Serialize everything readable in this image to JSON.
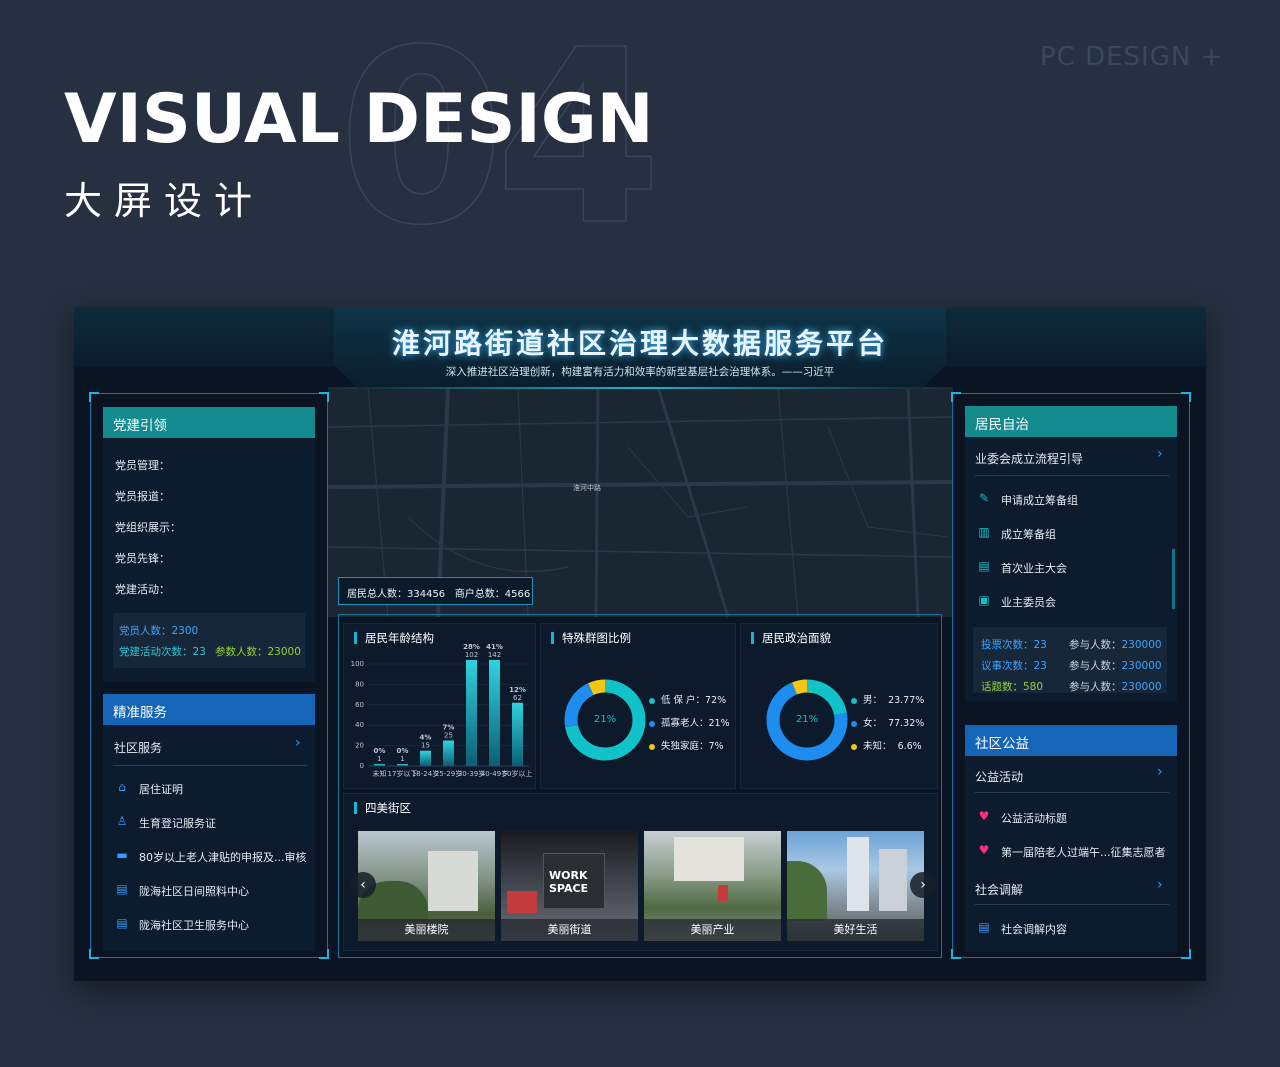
{
  "page": {
    "corner_tag": "PC DESIGN +",
    "big_number": "04",
    "title": "VISUAL DESIGN",
    "subtitle": "大屏设计"
  },
  "dashboard": {
    "title": "淮河路街道社区治理大数据服务平台",
    "quote": "深入推进社区治理创新，构建富有活力和效率的新型基层社会治理体系。——习近平",
    "map_road_label": "淮河中路",
    "population": {
      "residents_label": "居民总人数：",
      "residents_value": "334456",
      "merchants_label": "商户总数：",
      "merchants_value": "4566"
    }
  },
  "left": {
    "party": {
      "title": "党建引领",
      "items": [
        "党员管理：",
        "党员报道：",
        "党组织展示：",
        "党员先锋：",
        "党建活动："
      ],
      "stats": {
        "members_label": "党员人数：",
        "members_value": "2300",
        "activities_label": "党建活动次数：",
        "activities_value": "23",
        "participants_label": "参数人数：",
        "participants_value": "23000"
      }
    },
    "service": {
      "title": "精准服务",
      "section": "社区服务",
      "items": [
        {
          "label": "居住证明",
          "icon": "home-icon"
        },
        {
          "label": "生育登记服务证",
          "icon": "baby-icon"
        },
        {
          "label": "80岁以上老人津贴的申报及...审核",
          "icon": "card-icon"
        },
        {
          "label": "陇海社区日间照料中心",
          "icon": "document-icon"
        },
        {
          "label": "陇海社区卫生服务中心",
          "icon": "document-icon"
        }
      ]
    }
  },
  "center": {
    "age_chart_title": "居民年龄结构",
    "special_title": "特殊群图比例",
    "political_title": "居民政治面貌",
    "streets_title": "四美街区",
    "special_center": "21%",
    "special_legend": [
      {
        "label": "低 保 户：",
        "value": "72%",
        "color": "#11c3c9"
      },
      {
        "label": "孤寡老人：",
        "value": "21%",
        "color": "#1e8df0"
      },
      {
        "label": "失独家庭：",
        "value": "7%",
        "color": "#f5c614"
      }
    ],
    "political_center": "21%",
    "political_legend": [
      {
        "label": "男：",
        "value": "23.77%",
        "color": "#11c3c9"
      },
      {
        "label": "女：",
        "value": "77.32%",
        "color": "#1e8df0"
      },
      {
        "label": "未知：",
        "value": "6.6%",
        "color": "#f5c614"
      }
    ],
    "photos": [
      "美丽楼院",
      "美丽街道",
      "美丽产业",
      "美好生活"
    ]
  },
  "chart_data": [
    {
      "type": "bar",
      "title": "居民年龄结构",
      "categories": [
        "未知",
        "17岁以下",
        "18-24岁",
        "25-29岁",
        "30-39岁",
        "40-49岁",
        "50岁以上"
      ],
      "values": [
        1,
        1,
        15,
        25,
        102,
        142,
        62
      ],
      "percent_labels": [
        "0%",
        "0%",
        "4%",
        "7%",
        "28%",
        "41%",
        "12%"
      ],
      "yticks": [
        0,
        20,
        40,
        60,
        80,
        100
      ],
      "ylim": [
        0,
        100
      ]
    },
    {
      "type": "pie",
      "title": "特殊群图比例",
      "labels": [
        "低保户",
        "孤寡老人",
        "失独家庭"
      ],
      "values": [
        72,
        21,
        7
      ]
    },
    {
      "type": "pie",
      "title": "居民政治面貌",
      "labels": [
        "男",
        "女",
        "未知"
      ],
      "values": [
        23.77,
        77.32,
        6.6
      ]
    }
  ],
  "right": {
    "autonomy": {
      "title": "居民自治",
      "section": "业委会成立流程引导",
      "items": [
        {
          "label": "申请成立筹备组",
          "icon": "pen-icon"
        },
        {
          "label": "成立筹备组",
          "icon": "book-icon"
        },
        {
          "label": "首次业主大会",
          "icon": "chat-icon"
        },
        {
          "label": "业主委员会",
          "icon": "clipboard-icon"
        }
      ],
      "stats": [
        {
          "label": "投票次数：",
          "value": "23",
          "plabel": "参与人数：",
          "pvalue": "230000"
        },
        {
          "label": "议事次数：",
          "value": "23",
          "plabel": "参与人数：",
          "pvalue": "230000"
        },
        {
          "label": "话题数：",
          "value": "580",
          "plabel": "参与人数：",
          "pvalue": "230000"
        }
      ]
    },
    "welfare": {
      "title": "社区公益",
      "section1": "公益活动",
      "items": [
        "公益活动标题",
        "第一届陪老人过端午...征集志愿者"
      ],
      "section2": "社会调解",
      "mediation_item": "社会调解内容"
    }
  },
  "colors": {
    "teal": "#138a8e",
    "blue": "#1565b8",
    "accent": "#11c3c9",
    "chart_blue": "#1e8df0",
    "chart_yellow": "#f5c614"
  }
}
